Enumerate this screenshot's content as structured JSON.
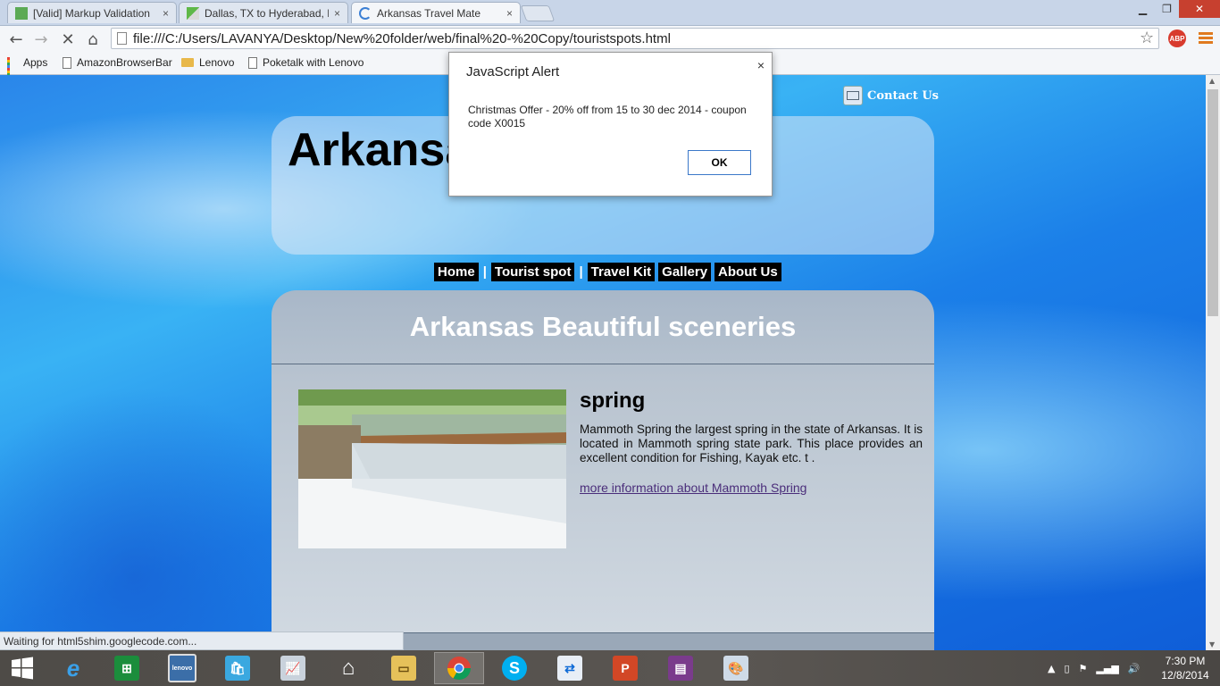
{
  "browser": {
    "tabs": [
      {
        "title": "[Valid] Markup Validation",
        "close": "×"
      },
      {
        "title": "Dallas, TX to Hyderabad, I",
        "close": "×"
      },
      {
        "title": "Arkansas Travel Mate",
        "close": "×"
      }
    ],
    "window_buttons": {
      "minimize": "▁",
      "restore": "❐",
      "close": "✕"
    },
    "url": "file:///C:/Users/LAVANYA/Desktop/New%20folder/web/final%20-%20Copy/touristspots.html",
    "abp_label": "ABP",
    "bookmarks": [
      "Apps",
      "AmazonBrowserBar",
      "Lenovo",
      "Poketalk with Lenovo"
    ],
    "status_text": "Waiting for html5shim.googlecode.com..."
  },
  "page": {
    "contact_label": "Contact Us",
    "site_title": "Arkansas",
    "nav": [
      "Home",
      "Tourist spot",
      "Travel Kit",
      "Gallery",
      "About Us"
    ],
    "nav_separator": "|",
    "section_heading": "Arkansas Beautiful sceneries",
    "spot": {
      "title": "spring",
      "description": "Mammoth Spring the largest spring in the state of Arkansas. It is located in Mammoth spring state park. This place provides an excellent condition for Fishing, Kayak etc. t .",
      "link": "more information about Mammoth Spring"
    }
  },
  "alert": {
    "title": "JavaScript Alert",
    "close": "×",
    "message": "Christmas Offer - 20% off from 15 to 30 dec 2014 - coupon code X0015",
    "ok_label": "OK"
  },
  "taskbar": {
    "time": "7:30 PM",
    "date": "12/8/2014"
  }
}
